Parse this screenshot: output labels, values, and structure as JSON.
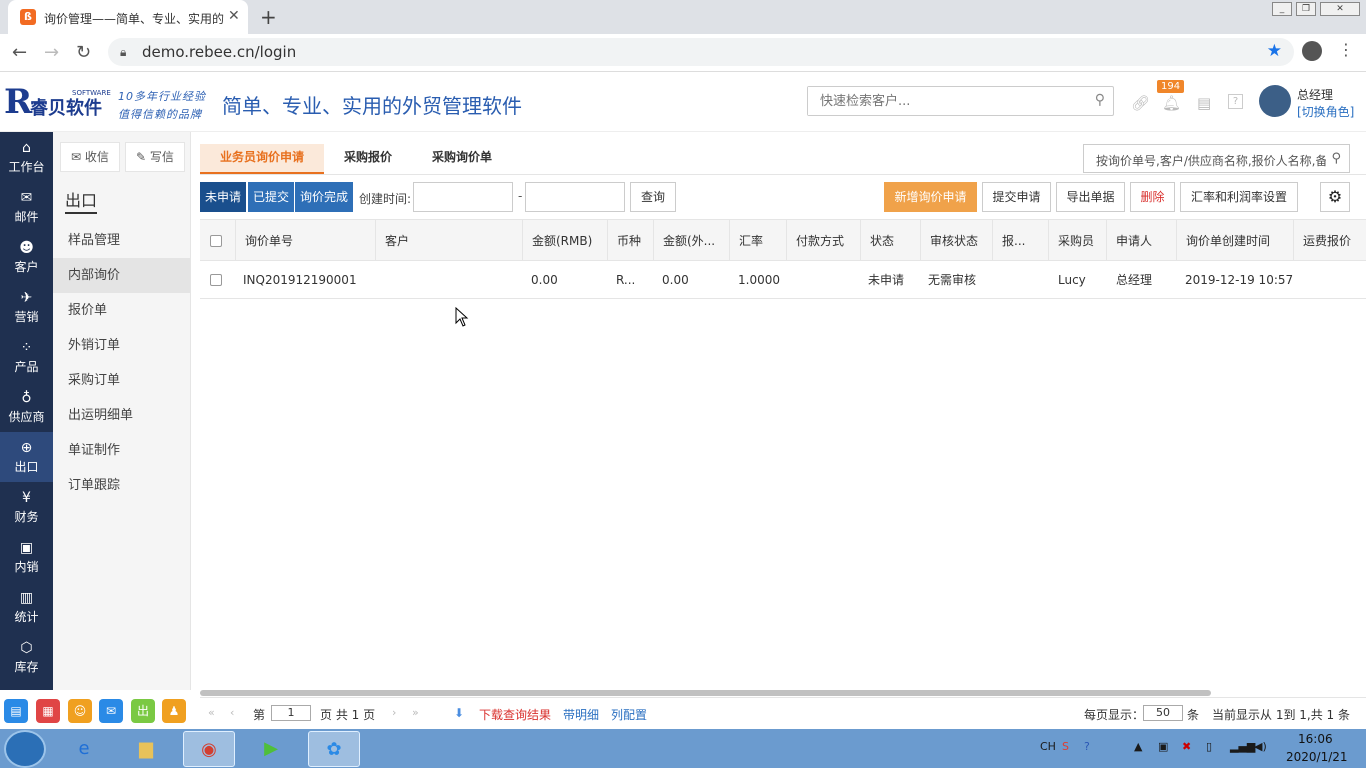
{
  "browser": {
    "tab_title": "询价管理——简单、专业、实用的",
    "tab_favicon": "ß",
    "url": "demo.rebee.cn/login",
    "new_tab": "+",
    "close": "✕"
  },
  "header": {
    "logo_letter": "R",
    "logo_text": "睿贝软件",
    "logo_sub": "SOFTWARE",
    "slogan1": "10多年行业经验",
    "slogan2": "值得信赖的品牌",
    "title": "简单、专业、实用的外贸管理软件",
    "search_placeholder": "快速检索客户...",
    "notification_count": "194",
    "user_name": "总经理",
    "switch_role": "[切换角色]"
  },
  "leftnav": [
    {
      "label": "工作台",
      "icon": "⌂"
    },
    {
      "label": "邮件",
      "icon": "✉"
    },
    {
      "label": "客户",
      "icon": "☻"
    },
    {
      "label": "营销",
      "icon": "✈"
    },
    {
      "label": "产品",
      "icon": "⁘"
    },
    {
      "label": "供应商",
      "icon": "♁"
    },
    {
      "label": "出口",
      "icon": "⊕"
    },
    {
      "label": "财务",
      "icon": "¥"
    },
    {
      "label": "内销",
      "icon": "▣"
    },
    {
      "label": "统计",
      "icon": "▥"
    },
    {
      "label": "库存",
      "icon": "⬡"
    }
  ],
  "subnav": {
    "receive": "收信",
    "write": "写信",
    "section_title": "出口",
    "items": [
      "样品管理",
      "内部询价",
      "报价单",
      "外销订单",
      "采购订单",
      "出运明细单",
      "单证制作",
      "订单跟踪"
    ]
  },
  "main": {
    "tabs": [
      "业务员询价申请",
      "采购报价",
      "采购询价单"
    ],
    "search_placeholder": "按询价单号,客户/供应商名称,报价人名称,备",
    "status_filters": [
      "未申请",
      "已提交",
      "询价完成"
    ],
    "create_time_label": "创建时间:",
    "date_sep": "-",
    "query_btn": "查询",
    "actions": [
      "新增询价申请",
      "提交申请",
      "导出单据",
      "删除",
      "汇率和利润率设置"
    ],
    "columns": [
      "询价单号",
      "客户",
      "金额(RMB)",
      "币种",
      "金额(外...",
      "汇率",
      "付款方式",
      "状态",
      "审核状态",
      "报...",
      "采购员",
      "申请人",
      "询价单创建时间",
      "运费报价"
    ],
    "rows": [
      [
        "INQ201912190001",
        "",
        "0.00",
        "R...",
        "0.00",
        "1.0000",
        "",
        "未申请",
        "无需审核",
        "",
        "Lucy",
        "总经理",
        "2019-12-19 10:57",
        ""
      ]
    ]
  },
  "pager": {
    "first": "«",
    "prev": "‹",
    "page_prefix": "第",
    "page": "1",
    "page_suffix": "页 共 1 页",
    "next": "›",
    "last": "»",
    "download": "下载查询结果",
    "detail": "带明细",
    "columns": "列配置",
    "per_page_label": "每页显示：",
    "per_page": "50",
    "per_page_unit": "条",
    "summary": "当前显示从 1到 1,共 1 条"
  },
  "floating_apps": [
    "▤",
    "▦",
    "☺",
    "✉",
    "出",
    "♟"
  ],
  "taskbar": {
    "lang": "CH",
    "time": "16:06",
    "date": "2020/1/21"
  },
  "colors": {
    "nav_dark": "#1f3050",
    "accent_orange": "#e8711f",
    "brand_blue": "#2a5db0"
  }
}
